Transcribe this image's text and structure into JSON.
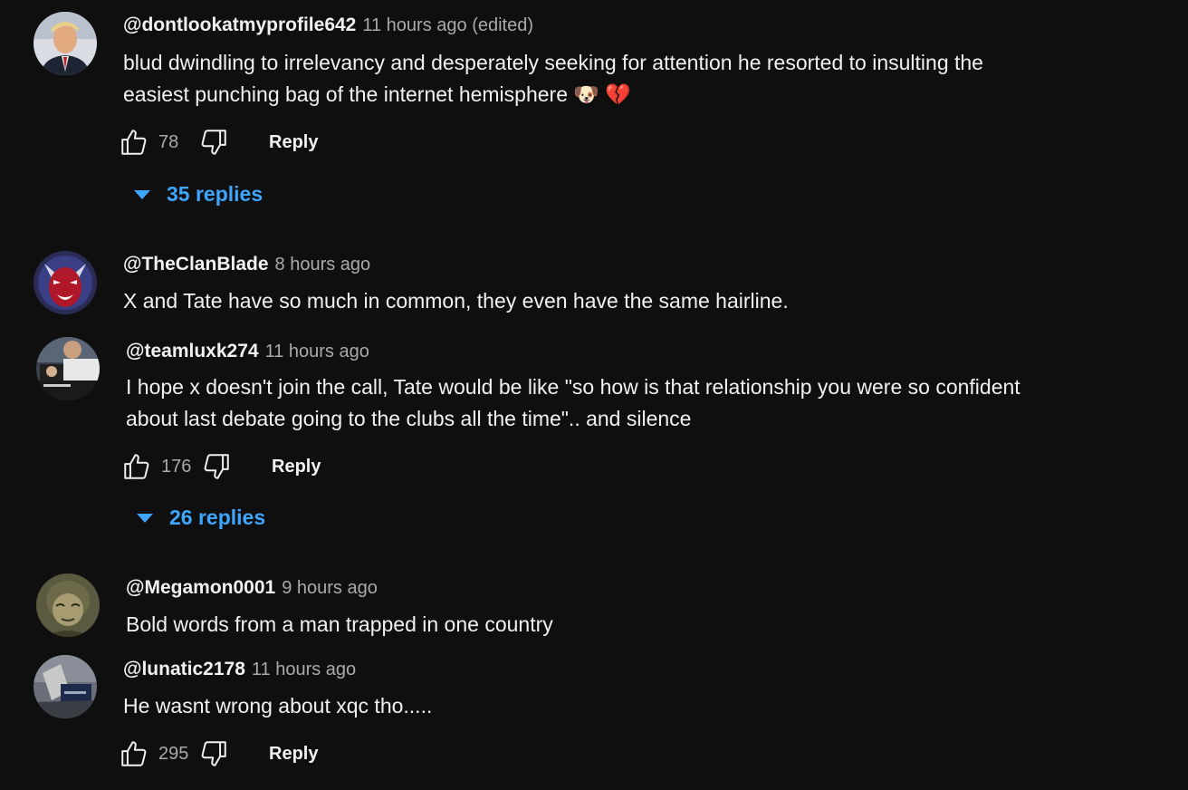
{
  "comments": [
    {
      "author": "@dontlookatmyprofile642",
      "time": "11 hours ago (edited)",
      "text_line1": "blud dwindling to irrelevancy and desperately seeking for attention he resorted to insulting the",
      "text_line2": "easiest punching bag of the internet hemisphere",
      "emoji": "🐶 💔",
      "likes": "78",
      "reply_label": "Reply",
      "replies_label": "35 replies"
    },
    {
      "author": "@TheClanBlade",
      "time": "8 hours ago",
      "text_line1": "X and Tate have so much in common, they even have the same hairline."
    },
    {
      "author": "@teamluxk274",
      "time": "11 hours ago",
      "text_line1": "I hope x doesn't join the call, Tate would be like \"so how is that relationship you were so confident",
      "text_line2": "about last debate going to the clubs all the time\".. and silence",
      "likes": "176",
      "reply_label": "Reply",
      "replies_label": "26 replies"
    },
    {
      "author": "@Megamon0001",
      "time": "9 hours ago",
      "text_line1": "Bold words from a man trapped in one country"
    },
    {
      "author": "@lunatic2178",
      "time": "11 hours ago",
      "text_line1": "He wasnt wrong about xqc tho.....",
      "likes": "295",
      "reply_label": "Reply"
    }
  ],
  "colors": {
    "background": "#0f0f0f",
    "text": "#f1f1f1",
    "secondary": "#aaaaaa",
    "link": "#3ea6ff"
  },
  "icons": [
    "thumb-up-icon",
    "thumb-down-icon",
    "caret-down-icon"
  ]
}
